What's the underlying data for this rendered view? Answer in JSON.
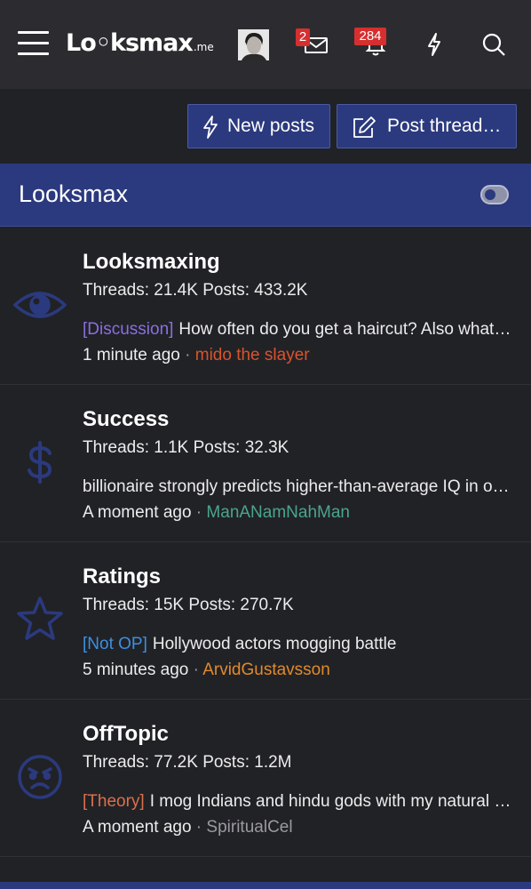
{
  "header": {
    "logo_main": "Lo◦ksmax",
    "logo_suffix": ".me",
    "messages_count": "2",
    "alerts_count": "284",
    "icons": [
      "menu-icon",
      "avatar",
      "envelope-icon",
      "bell-icon",
      "bolt-icon",
      "search-icon"
    ]
  },
  "actions": {
    "new_posts": "New posts",
    "post_thread": "Post thread…"
  },
  "section": {
    "title": "Looksmax"
  },
  "nodes": [
    {
      "title": "Looksmaxing",
      "stats": "Threads: 21.4K Posts: 433.2K",
      "prefix": "[Discussion]",
      "prefix_color": "#8a6fe0",
      "latest": "How often do you get a haircut? Also what hairstyle do you have",
      "time": "1 minute ago",
      "user": "mido the slayer",
      "user_color": "#d9532c",
      "icon": "eye-icon"
    },
    {
      "title": "Success",
      "stats": "Threads: 1.1K Posts: 32.3K",
      "prefix": "",
      "prefix_color": "",
      "latest": "billionaire strongly predicts higher-than-average IQ in offspring",
      "time": "A moment ago",
      "user": "ManANamNahMan",
      "user_color": "#4aa58f",
      "icon": "dollar-icon"
    },
    {
      "title": "Ratings",
      "stats": "Threads: 15K Posts: 270.7K",
      "prefix": "[Not OP]",
      "prefix_color": "#3d8fe0",
      "latest": "Hollywood actors mogging battle",
      "time": "5 minutes ago",
      "user": "ArvidGustavsson",
      "user_color": "#e08a2c",
      "icon": "star-icon"
    },
    {
      "title": "OffTopic",
      "stats": "Threads: 77.2K Posts: 1.2M",
      "prefix": "[Theory]",
      "prefix_color": "#d9704a",
      "latest": "I mog Indians and hindu gods with my natural face",
      "time": "A moment ago",
      "user": "SpiritualCel",
      "user_color": "#9a9aa0",
      "icon": "angry-face-icon"
    }
  ],
  "colors": {
    "accent": "#2b3a7e",
    "background": "#212226",
    "header": "#2c2c30",
    "node_icon": "#2b3a7e",
    "badge": "#d62f2f"
  }
}
